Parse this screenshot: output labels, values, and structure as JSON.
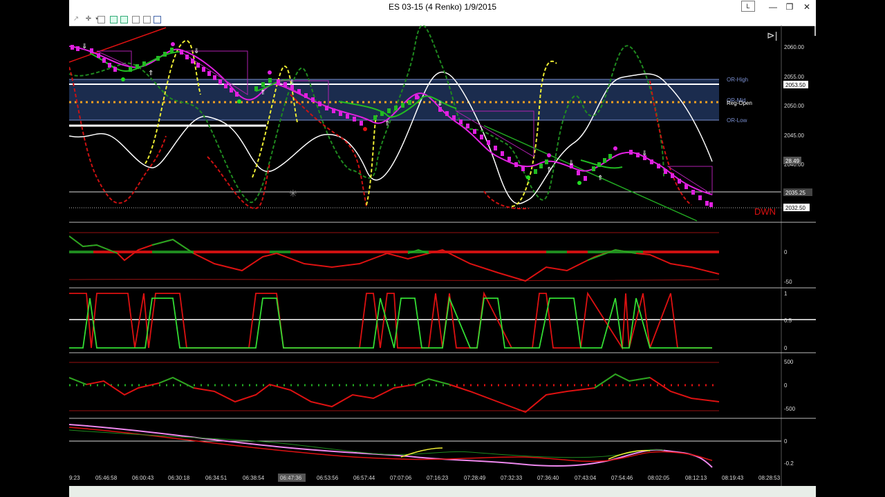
{
  "window": {
    "title": "ES 03-15 (4 Renko)  1/9/2015",
    "l_button": "L",
    "minimize_glyph": "—",
    "restore_glyph": "❐",
    "close_glyph": "✕"
  },
  "toolbar": {
    "icons": [
      "pointer-icon",
      "crosshair-icon",
      "properties-icon",
      "bars-icon",
      "chart-style-icon",
      "indicators-icon",
      "templates-icon",
      "data-box-icon"
    ]
  },
  "price_panel": {
    "y_ticks": [
      "2060.00",
      "2055.00",
      "2050.00",
      "2045.00",
      "2040.00"
    ],
    "markers": [
      "2053.50",
      "28.49",
      "2035.25",
      "2032.50"
    ],
    "or_high": "OR-High",
    "or_mid": "OR-Mid",
    "reg_open": "Reg-Open",
    "or_low": "OR-Low",
    "direction": "DWN"
  },
  "panel2": {
    "ticks": [
      "0",
      "-50"
    ]
  },
  "panel3": {
    "ticks": [
      "1",
      "0.5",
      "0"
    ]
  },
  "panel4": {
    "ticks": [
      "500",
      "0",
      "-500"
    ]
  },
  "panel5": {
    "ticks": [
      "0",
      "-0.2"
    ]
  },
  "time_axis": [
    "9:23",
    "05:46:58",
    "06:00:43",
    "06:30:18",
    "06:34:51",
    "06:38:54",
    "06:47:36",
    "06:53:56",
    "06:57:44",
    "07:07:06",
    "07:16:23",
    "07:28:49",
    "07:32:33",
    "07:36:40",
    "07:43:04",
    "07:54:46",
    "08:02:05",
    "08:12:13",
    "08:19:43",
    "08:28:53"
  ],
  "colors": {
    "background": "#000000",
    "band": "#1a2a4a",
    "magenta": "#e020e0",
    "green": "#22bb22",
    "red": "#dd1111",
    "yellow": "#eeee33",
    "white": "#ffffff",
    "orange": "#f0a020"
  }
}
